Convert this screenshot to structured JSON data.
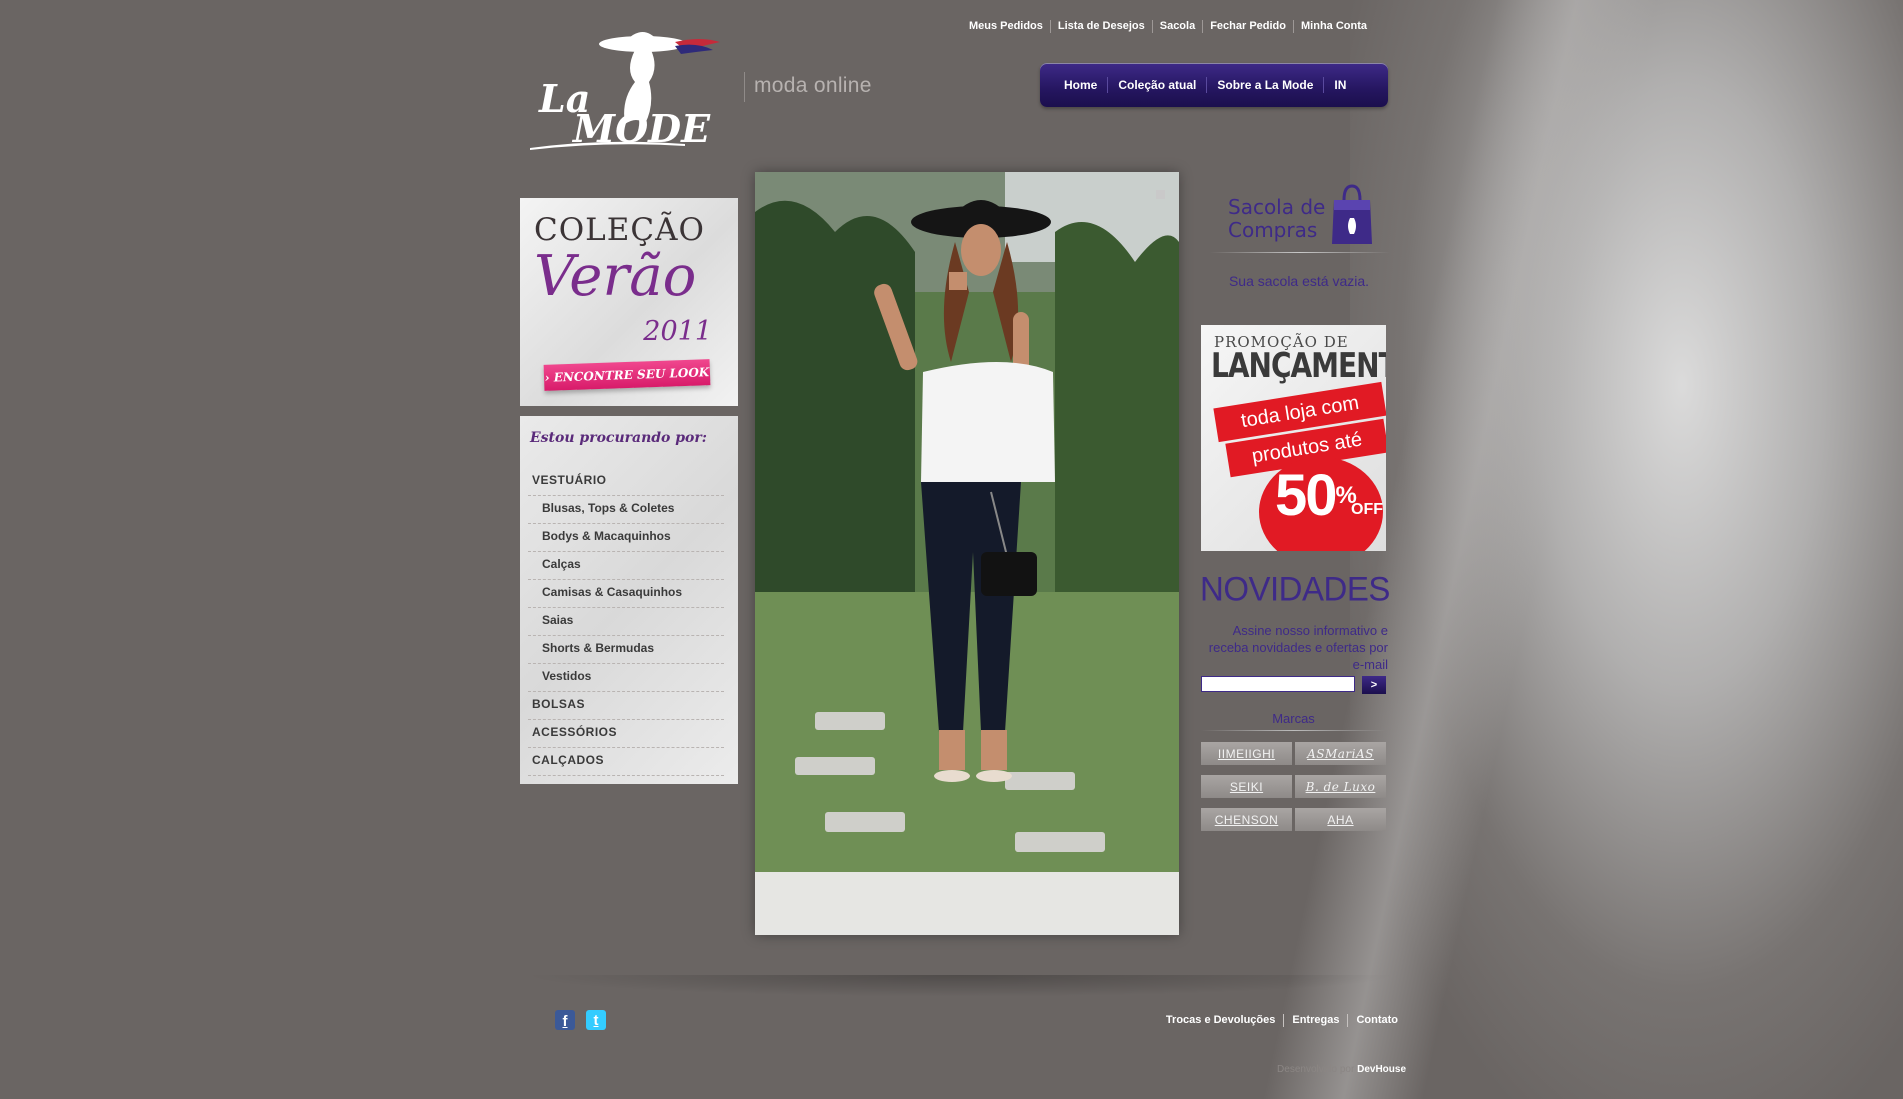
{
  "header": {
    "top_links": [
      "Meus Pedidos",
      "Lista de Desejos",
      "Sacola",
      "Fechar Pedido",
      "Minha Conta"
    ],
    "logo_text": "La MODE",
    "tagline": "moda online",
    "nav": [
      "Home",
      "Coleção atual",
      "Sobre a La Mode",
      "IN"
    ]
  },
  "promo_verao": {
    "line1": "COLEÇÃO",
    "line2": "Verão",
    "line3": "2011",
    "button": "ENCONTRE SEU LOOK"
  },
  "categories": {
    "title": "Estou procurando por:",
    "items": [
      {
        "label": "VESTUÁRIO",
        "level": "main"
      },
      {
        "label": "Blusas, Tops & Coletes",
        "level": "sub"
      },
      {
        "label": "Bodys & Macaquinhos",
        "level": "sub"
      },
      {
        "label": "Calças",
        "level": "sub"
      },
      {
        "label": "Camisas & Casaquinhos",
        "level": "sub"
      },
      {
        "label": "Saias",
        "level": "sub"
      },
      {
        "label": "Shorts & Bermudas",
        "level": "sub"
      },
      {
        "label": "Vestidos",
        "level": "sub"
      },
      {
        "label": "BOLSAS",
        "level": "main"
      },
      {
        "label": "ACESSÓRIOS",
        "level": "main"
      },
      {
        "label": "CALÇADOS",
        "level": "main"
      }
    ]
  },
  "cart": {
    "title_line1": "Sacola de",
    "title_line2": "Compras",
    "empty_message": "Sua sacola está vazia."
  },
  "promo_lancamento": {
    "line1": "PROMOÇÃO DE",
    "line2": "LANÇAMENTO",
    "band1": "toda loja com",
    "band2": "produtos até",
    "percent": "50",
    "percent_sign": "%",
    "off": "OFF"
  },
  "newsletter": {
    "title": "NOVIDADES",
    "text": "Assine nosso informativo e receba novidades e ofertas por e-mail",
    "input_value": "",
    "submit": ">"
  },
  "brands": {
    "title": "Marcas",
    "items": [
      "IIMEIIGHI",
      "ASMariAS",
      "SEIKI",
      "B. de Luxo",
      "CHENSON",
      "AHA"
    ]
  },
  "footer": {
    "links": [
      "Trocas e Devoluções",
      "Entregas",
      "Contato"
    ],
    "credit_prefix": "Desenvolvido por",
    "credit_name": "DevHouse"
  },
  "colors": {
    "page_bg": "#6a6563",
    "brand_purple": "#3e2a88",
    "promo_red": "#e11a24",
    "promo_pink": "#d81b6a"
  }
}
